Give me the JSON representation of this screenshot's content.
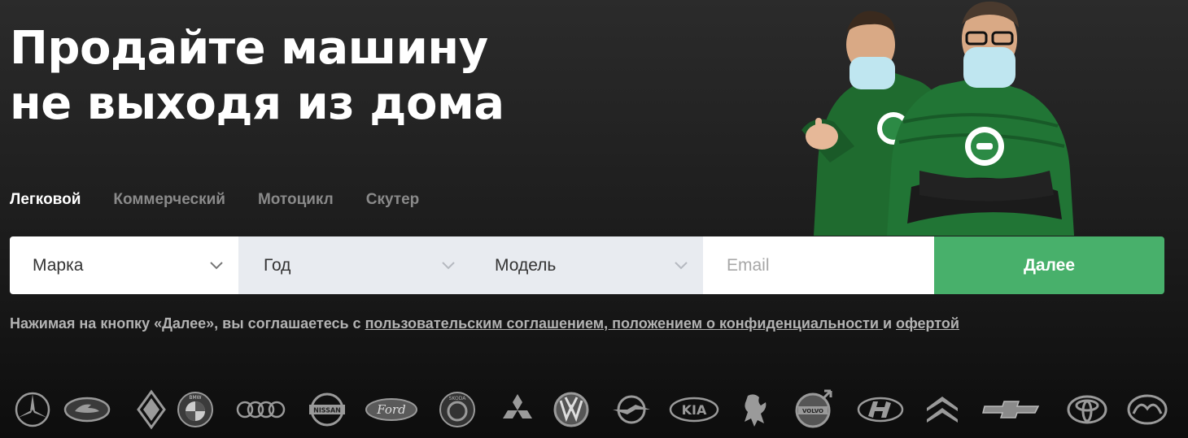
{
  "headline": {
    "line1": "Продайте машину",
    "line2": "не выходя из дома"
  },
  "tabs": [
    {
      "label": "Легковой",
      "active": true
    },
    {
      "label": "Коммерческий",
      "active": false
    },
    {
      "label": "Мотоцикл",
      "active": false
    },
    {
      "label": "Скутер",
      "active": false
    }
  ],
  "form": {
    "brand_value": "Марка",
    "year_value": "Год",
    "model_value": "Модель",
    "email_placeholder": "Email",
    "submit_label": "Далее"
  },
  "legal": {
    "prefix": "Нажимая на кнопку «Далее», вы соглашаетесь с ",
    "link_agreement": "пользовательским соглашением, положением о конфиденциальности ",
    "and": " и ",
    "link_offer": "офертой"
  },
  "brand_logos": [
    "mercedes-logo",
    "lada-logo",
    "renault-logo",
    "bmw-logo",
    "audi-logo",
    "nissan-logo",
    "ford-logo",
    "skoda-logo",
    "mitsubishi-logo",
    "volkswagen-logo",
    "opel-logo",
    "kia-logo",
    "peugeot-logo",
    "volvo-logo",
    "hyundai-logo",
    "citroen-logo",
    "chevrolet-logo",
    "toyota-logo",
    "mazda-logo"
  ],
  "brand_logo_text": {
    "bmw": "BMW",
    "audi": "",
    "nissan": "NISSAN",
    "ford": "Ford",
    "skoda": "SKODA",
    "kia": "KIA",
    "volvo": "VOLVO"
  },
  "colors": {
    "accent": "#48b06b",
    "background": "#1c1c1c",
    "field_alt": "#e8ebf0",
    "mascot_green": "#1f6b2f"
  }
}
